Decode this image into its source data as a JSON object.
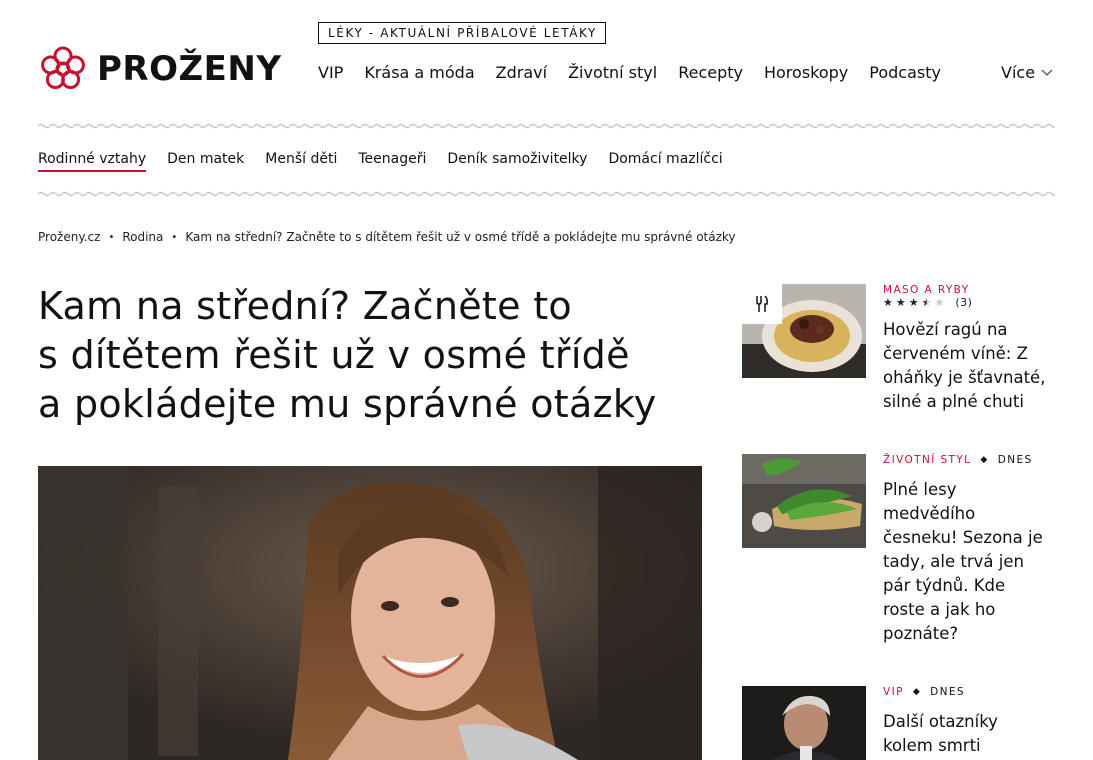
{
  "brand": {
    "name": "PROŽENY",
    "color": "#c8102e"
  },
  "header": {
    "top_link": "LÉKY - AKTUÁLNÍ PŘÍBALOVÉ LETÁKY",
    "nav": [
      "VIP",
      "Krása a móda",
      "Zdraví",
      "Životní styl",
      "Recepty",
      "Horoskopy",
      "Podcasty"
    ],
    "more_label": "Více",
    "more_icon": "chevron-down-icon"
  },
  "subnav": {
    "items": [
      "Rodinné vztahy",
      "Den matek",
      "Menší děti",
      "Teenageři",
      "Deník samoživitelky",
      "Domácí mazlíčci"
    ],
    "active": "Rodinné vztahy"
  },
  "breadcrumb": [
    "Proženy.cz",
    "Rodina",
    "Kam na střední? Začněte to s dítětem řešit už v osmé třídě a pokládejte mu správné otázky"
  ],
  "article": {
    "title_lines": [
      "Kam na střední? Začněte to",
      "s dítětem řešit už v osmé třídě",
      "a pokládejte mu správné otázky"
    ]
  },
  "sidebar": [
    {
      "category": "MASO A RYBY",
      "rating": 3.5,
      "rating_count": "(3)",
      "title_lines": [
        "Hovězí ragú na",
        "červeném víně: Z",
        "oháňky je šťavnaté,",
        "silné a plné chuti"
      ],
      "icon": "fork-knife-icon"
    },
    {
      "category": "ŽIVOTNÍ STYL",
      "when": "DNES",
      "title_lines": [
        "Plné lesy",
        "medvědího",
        "česneku! Sezona je",
        "tady, ale trvá jen",
        "pár týdnů. Kde",
        "roste a jak ho",
        "poznáte?"
      ]
    },
    {
      "category": "VIP",
      "when": "DNES",
      "title_lines": [
        "Další otazníky",
        "kolem smrti"
      ]
    }
  ]
}
